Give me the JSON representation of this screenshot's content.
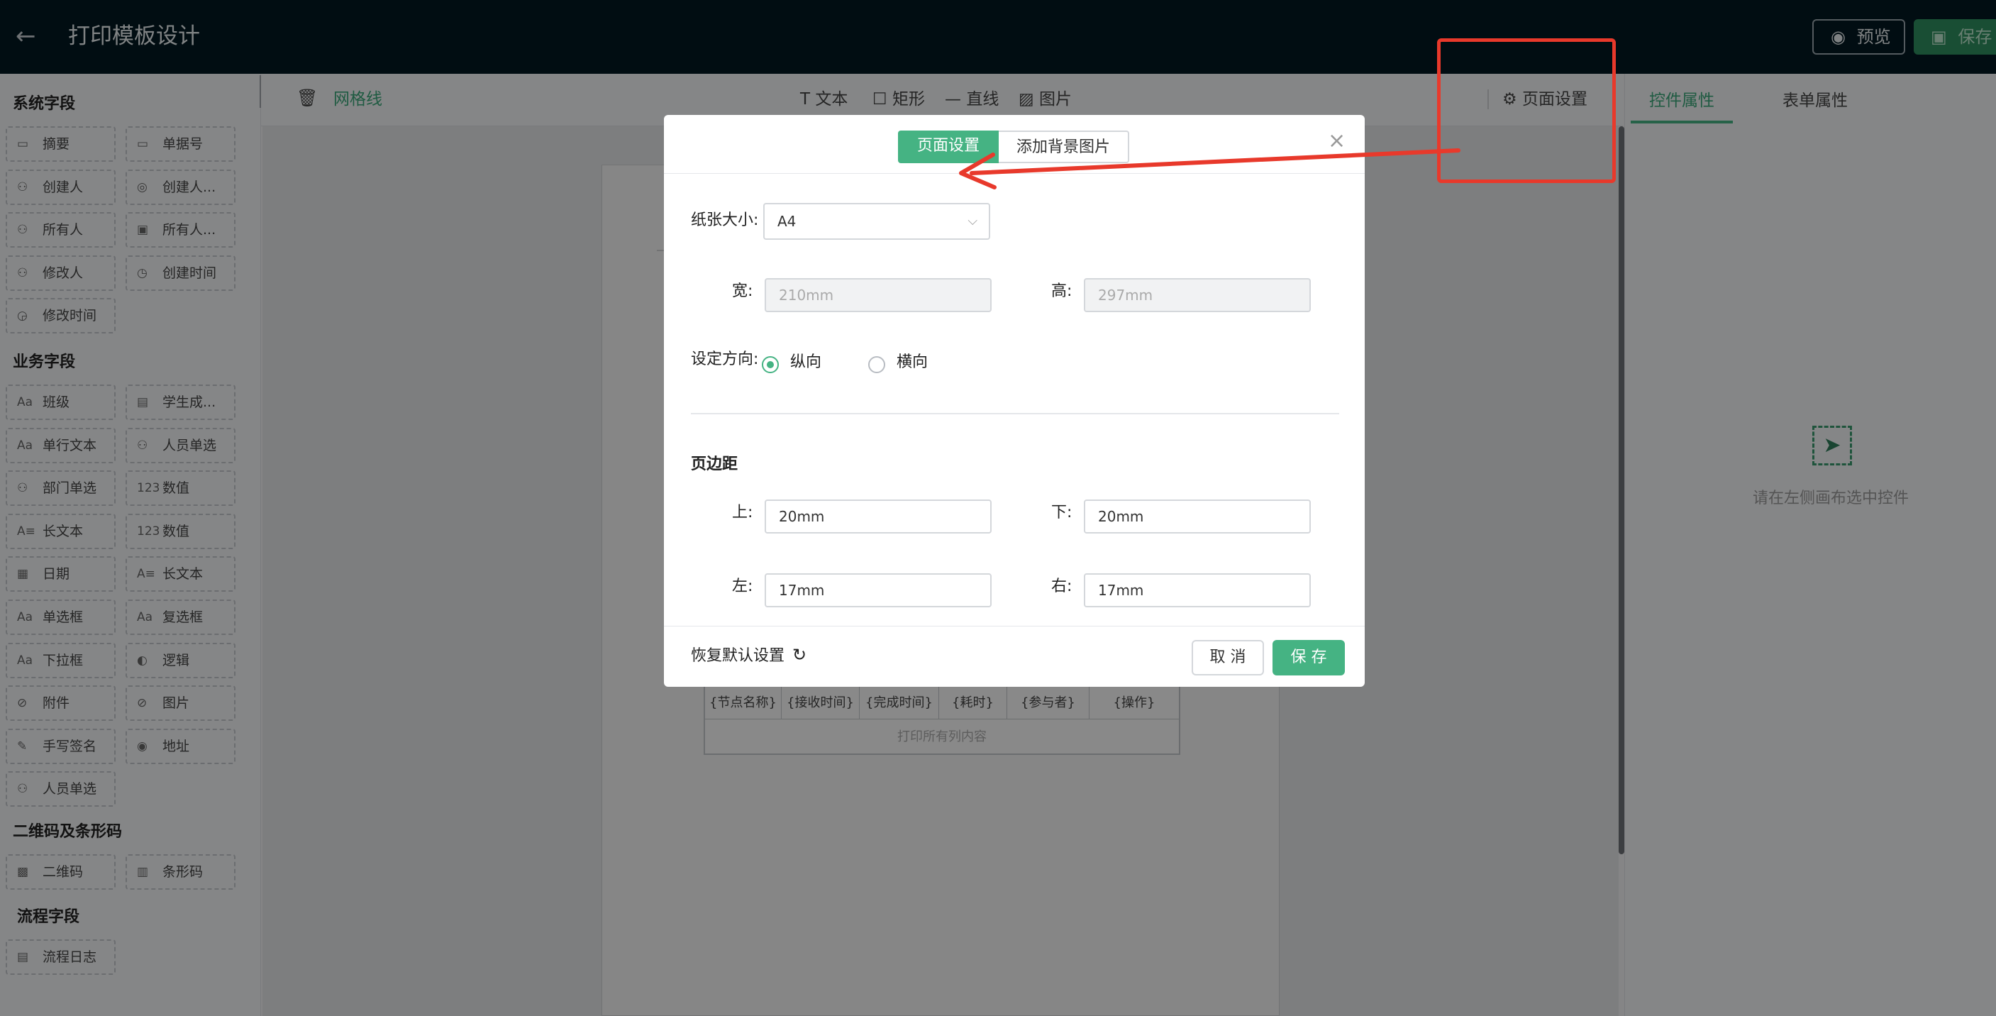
{
  "topbar": {
    "title": "打印模板设计",
    "preview_label": "预览",
    "save_label": "保存"
  },
  "left_panel": {
    "sections": [
      {
        "title": "系统字段",
        "items": [
          {
            "label": "摘要",
            "icon": "card-icon",
            "glyph": "▭"
          },
          {
            "label": "单据号",
            "icon": "card-icon",
            "glyph": "▭"
          },
          {
            "label": "创建人",
            "icon": "user-icon",
            "glyph": "⚇"
          },
          {
            "label": "创建人...",
            "icon": "dept-icon",
            "glyph": "◎"
          },
          {
            "label": "所有人",
            "icon": "user-icon",
            "glyph": "⚇"
          },
          {
            "label": "所有人...",
            "icon": "image-icon",
            "glyph": "▣"
          },
          {
            "label": "修改人",
            "icon": "user-icon",
            "glyph": "⚇"
          },
          {
            "label": "创建时间",
            "icon": "clock-icon",
            "glyph": "◷"
          },
          {
            "label": "修改时间",
            "icon": "clock-icon",
            "glyph": "◶"
          }
        ]
      },
      {
        "title": "业务字段",
        "items": [
          {
            "label": "班级",
            "icon": "text-icon",
            "glyph": "Aa"
          },
          {
            "label": "学生成...",
            "icon": "list-icon",
            "glyph": "▤"
          },
          {
            "label": "单行文本",
            "icon": "text-icon",
            "glyph": "Aa"
          },
          {
            "label": "人员单选",
            "icon": "user-icon",
            "glyph": "⚇"
          },
          {
            "label": "部门单选",
            "icon": "user-icon",
            "glyph": "⚇"
          },
          {
            "label": "数值",
            "icon": "number-icon",
            "glyph": "123"
          },
          {
            "label": "长文本",
            "icon": "longtext-icon",
            "glyph": "A≡"
          },
          {
            "label": "数值",
            "icon": "number-icon",
            "glyph": "123"
          },
          {
            "label": "日期",
            "icon": "calendar-icon",
            "glyph": "▦"
          },
          {
            "label": "长文本",
            "icon": "longtext-icon",
            "glyph": "A≡"
          },
          {
            "label": "单选框",
            "icon": "text-icon",
            "glyph": "Aa"
          },
          {
            "label": "复选框",
            "icon": "text-icon",
            "glyph": "Aa"
          },
          {
            "label": "下拉框",
            "icon": "text-icon",
            "glyph": "Aa"
          },
          {
            "label": "逻辑",
            "icon": "toggle-icon",
            "glyph": "◐"
          },
          {
            "label": "附件",
            "icon": "paperclip-icon",
            "glyph": "⊘"
          },
          {
            "label": "图片",
            "icon": "paperclip-icon",
            "glyph": "⊘"
          },
          {
            "label": "手写签名",
            "icon": "pen-icon",
            "glyph": "✎"
          },
          {
            "label": "地址",
            "icon": "location-icon",
            "glyph": "◉"
          },
          {
            "label": "人员单选",
            "icon": "user-icon",
            "glyph": "⚇"
          }
        ]
      },
      {
        "title": "二维码及条形码",
        "items": [
          {
            "label": "二维码",
            "icon": "qrcode-icon",
            "glyph": "▩"
          },
          {
            "label": "条形码",
            "icon": "barcode-icon",
            "glyph": "▥"
          }
        ]
      },
      {
        "title": "流程字段",
        "items": [
          {
            "label": "流程日志",
            "icon": "log-icon",
            "glyph": "▤"
          }
        ]
      }
    ]
  },
  "toolbar": {
    "gridline_label": "网格线",
    "tools": [
      {
        "label": "文本",
        "glyph": "T",
        "icon": "text-tool-icon"
      },
      {
        "label": "矩形",
        "glyph": "☐",
        "icon": "rect-tool-icon"
      },
      {
        "label": "直线",
        "glyph": "—",
        "icon": "line-tool-icon"
      },
      {
        "label": "图片",
        "glyph": "▨",
        "icon": "image-tool-icon"
      }
    ],
    "page_settings_label": "页面设置"
  },
  "canvas_table": {
    "headers": [
      "{节点名称}",
      "{接收时间}",
      "{完成时间}",
      "{耗时}",
      "{参与者}",
      "{操作}"
    ],
    "footer": "打印所有列内容"
  },
  "right_panel": {
    "tabs": [
      "控件属性",
      "表单属性"
    ],
    "empty_hint": "请在左侧画布选中控件"
  },
  "dialog": {
    "tabs": [
      "页面设置",
      "添加背景图片"
    ],
    "paper_size_label": "纸张大小:",
    "paper_size_value": "A4",
    "width_label": "宽:",
    "width_value": "210mm",
    "height_label": "高:",
    "height_value": "297mm",
    "orientation_label": "设定方向:",
    "orientation_options": [
      "纵向",
      "横向"
    ],
    "margin_title": "页边距",
    "top_label": "上:",
    "top_value": "20mm",
    "bottom_label": "下:",
    "bottom_value": "20mm",
    "left_label": "左:",
    "left_value": "17mm",
    "right_label": "右:",
    "right_value": "17mm",
    "reset_label": "恢复默认设置",
    "cancel_label": "取 消",
    "save_label": "保 存"
  },
  "colors": {
    "accent": "#45b383",
    "topbar": "#031822",
    "annotation": "#e8392b"
  }
}
